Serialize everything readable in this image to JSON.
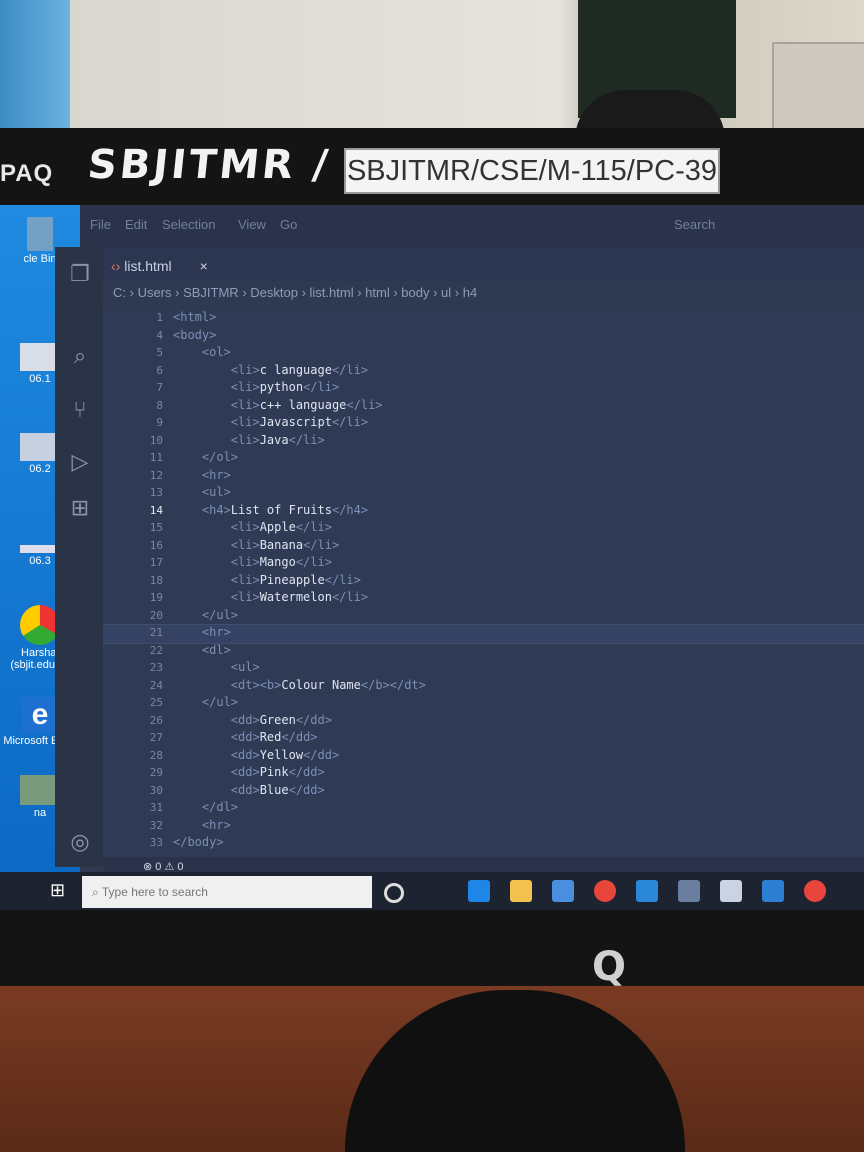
{
  "physical": {
    "monitor_brand_fragment": "PAQ",
    "handwritten_label": "SBJITMR /",
    "asset_tag": "SBJITMR/CSE/M-115/PC-39"
  },
  "desktop": {
    "icons": [
      {
        "label": "cle Bin",
        "icon": "recycle-bin-icon"
      },
      {
        "label": "06.1",
        "icon": "file-thumbnail-icon"
      },
      {
        "label": "06.2",
        "icon": "file-thumbnail-icon"
      },
      {
        "label": "06.3",
        "icon": "file-thumbnail-icon"
      },
      {
        "label": "Harshal (sbjit.edu.i...",
        "icon": "chrome-icon"
      },
      {
        "label": "Microsoft Edge",
        "icon": "edge-icon"
      },
      {
        "label": "na",
        "icon": "image-thumbnail-icon"
      }
    ]
  },
  "vscode": {
    "menu": [
      "File",
      "Edit",
      "Selection",
      "View",
      "Go"
    ],
    "search_hint": "Search",
    "tab": {
      "name": "list.html",
      "close": "×"
    },
    "breadcrumb": [
      "C:",
      "Users",
      "SBJITMR",
      "Desktop",
      "list.html",
      "html",
      "body",
      "ul",
      "h4"
    ],
    "current_line": "14",
    "lines": [
      {
        "num": "1",
        "code": "<html>"
      },
      {
        "num": "4",
        "code": "<body>"
      },
      {
        "num": "5",
        "code": "    <ol>"
      },
      {
        "num": "6",
        "code": "        <li>c language</li>"
      },
      {
        "num": "7",
        "code": "        <li>python</li>"
      },
      {
        "num": "8",
        "code": "        <li>c++ language</li>"
      },
      {
        "num": "9",
        "code": "        <li>Javascript</li>"
      },
      {
        "num": "10",
        "code": "        <li>Java</li>"
      },
      {
        "num": "11",
        "code": "    </ol>"
      },
      {
        "num": "12",
        "code": "    <hr>"
      },
      {
        "num": "13",
        "code": "    <ul>"
      },
      {
        "num": "14",
        "code": "    <h4>List of Fruits</h4>"
      },
      {
        "num": "15",
        "code": "        <li>Apple</li>"
      },
      {
        "num": "16",
        "code": "        <li>Banana</li>"
      },
      {
        "num": "17",
        "code": "        <li>Mango</li>"
      },
      {
        "num": "18",
        "code": "        <li>Pineapple</li>"
      },
      {
        "num": "19",
        "code": "        <li>Watermelon</li>"
      },
      {
        "num": "20",
        "code": "    </ul>"
      },
      {
        "num": "21",
        "code": "    <hr>"
      },
      {
        "num": "22",
        "code": "    <dl>"
      },
      {
        "num": "23",
        "code": "        <ul>"
      },
      {
        "num": "24",
        "code": "        <dt><b>Colour Name</b></dt>"
      },
      {
        "num": "25",
        "code": "    </ul>"
      },
      {
        "num": "26",
        "code": "        <dd>Green</dd>"
      },
      {
        "num": "27",
        "code": "        <dd>Red</dd>"
      },
      {
        "num": "28",
        "code": "        <dd>Yellow</dd>"
      },
      {
        "num": "29",
        "code": "        <dd>Pink</dd>"
      },
      {
        "num": "30",
        "code": "        <dd>Blue</dd>"
      },
      {
        "num": "31",
        "code": "    </dl>"
      },
      {
        "num": "32",
        "code": "    <hr>"
      },
      {
        "num": "33",
        "code": "</body>"
      }
    ],
    "status": {
      "errors": "0",
      "warnings": "0"
    }
  },
  "taskbar": {
    "search_placeholder": "Type here to search",
    "apps": [
      "cortana-icon",
      "task-view-icon",
      "edge-icon",
      "file-explorer-icon",
      "store-icon",
      "chrome-icon",
      "mail-icon",
      "network-icon",
      "weather-icon",
      "vscode-icon",
      "chrome-icon"
    ]
  },
  "colors": {
    "editor_bg": "#2f3a54",
    "taskbar_bg": "#1d2330",
    "desktop_blue": "#1479d6",
    "tag_text": "#7d8fb5"
  }
}
